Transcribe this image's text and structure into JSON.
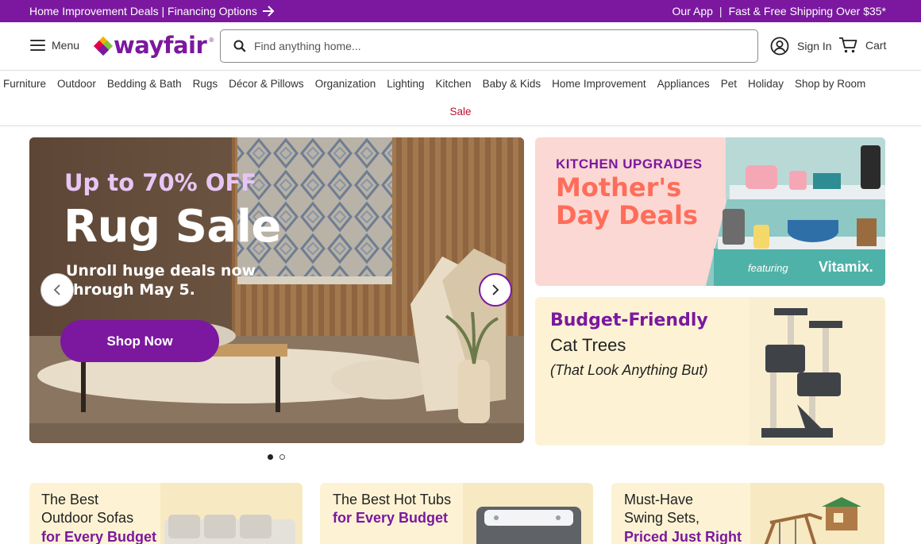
{
  "promo": {
    "left_text": "Home Improvement Deals | Financing Options",
    "our_app": "Our App",
    "separator": "|",
    "shipping": "Fast & Free Shipping Over $35*"
  },
  "header": {
    "menu_label": "Menu",
    "logo_text": "wayfair",
    "search_placeholder": "Find anything home...",
    "sign_in": "Sign In",
    "cart": "Cart"
  },
  "nav": {
    "categories": [
      "Furniture",
      "Outdoor",
      "Bedding & Bath",
      "Rugs",
      "Décor & Pillows",
      "Organization",
      "Lighting",
      "Kitchen",
      "Baby & Kids",
      "Home Improvement",
      "Appliances",
      "Pet",
      "Holiday",
      "Shop by Room"
    ],
    "sale": "Sale"
  },
  "hero": {
    "pre": "Up to 70% OFF",
    "title": "Rug Sale",
    "subtitle": "Unroll huge deals now through May 5.",
    "cta": "Shop Now"
  },
  "carousel": {
    "slides": 2,
    "active": 1
  },
  "kitchen": {
    "pre": "KITCHEN UPGRADES",
    "title": "Mother's Day Deals",
    "featuring": "featuring",
    "brand": "Vitamix."
  },
  "cattree": {
    "title": "Budget-Friendly",
    "subtitle": "Cat Trees",
    "note": "(That Look Anything But)"
  },
  "bottom_cards": [
    {
      "l1": "The Best",
      "l2": "Outdoor Sofas",
      "l3": "for Every Budget"
    },
    {
      "l1": "The Best Hot Tubs",
      "l2": "for Every Budget"
    },
    {
      "l1": "Must-Have",
      "l2": "Swing Sets,",
      "l3": "Priced Just Right"
    }
  ],
  "colors": {
    "brand": "#7b189f",
    "sale": "#b71234",
    "coral": "#ff6d5a",
    "cream": "#fdf3d4"
  }
}
